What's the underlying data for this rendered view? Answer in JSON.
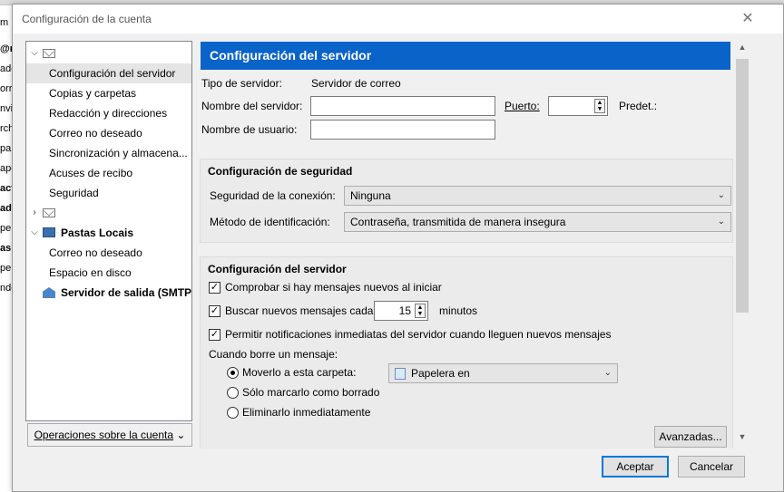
{
  "background": {
    "fragments": [
      "m",
      "@re",
      "ade",
      "orra",
      "nvia",
      "rch",
      "pan",
      "ape",
      "act",
      "ade",
      "pele",
      "as L",
      "pele",
      "nde"
    ]
  },
  "dialog": {
    "title": "Configuración de la cuenta",
    "close_icon": "close-icon"
  },
  "tree": {
    "items": [
      {
        "label": ""
      },
      {
        "label": "Configuración del servidor"
      },
      {
        "label": "Copias y carpetas"
      },
      {
        "label": "Redacción y direcciones"
      },
      {
        "label": "Correo no deseado"
      },
      {
        "label": "Sincronización y almacena..."
      },
      {
        "label": "Acuses de recibo"
      },
      {
        "label": "Seguridad"
      },
      {
        "label": ""
      },
      {
        "label": "Pastas Locais"
      },
      {
        "label": "Correo no deseado"
      },
      {
        "label": "Espacio en disco"
      },
      {
        "label": "Servidor de salida (SMTP)"
      }
    ],
    "account_ops": "Operaciones sobre la cuenta"
  },
  "main": {
    "header": "Configuración del servidor",
    "server_type_label": "Tipo de servidor:",
    "server_type_value": "Servidor de correo",
    "server_name_label": "Nombre del servidor:",
    "server_name_value": "",
    "port_label": "Puerto:",
    "port_value": "",
    "default_label": "Predet.:",
    "username_label": "Nombre de usuario:",
    "username_value": "",
    "security": {
      "title": "Configuración de seguridad",
      "connection_label": "Seguridad de la conexión:",
      "connection_value": "Ninguna",
      "auth_label": "Método de identificación:",
      "auth_value": "Contraseña, transmitida de manera insegura"
    },
    "server_settings": {
      "title": "Configuración del servidor",
      "check_new_label": "Comprobar si hay mensajes nuevos al iniciar",
      "check_every_label": "Buscar nuevos mensajes cada",
      "check_every_value": "15",
      "minutes_label": "minutos",
      "push_label": "Permitir notificaciones inmediatas del servidor cuando lleguen nuevos mensajes",
      "on_delete_label": "Cuando borre un mensaje:",
      "move_label": "Moverlo a esta carpeta:",
      "trash_folder": "Papelera en",
      "mark_label": "Sólo marcarlo como borrado",
      "remove_label": "Eliminarlo inmediatamente",
      "advanced_label": "Avanzadas..."
    }
  },
  "footer": {
    "accept": "Aceptar",
    "cancel": "Cancelar"
  },
  "colors": {
    "header_bg": "#0a63c9",
    "accent": "#0078d7"
  }
}
